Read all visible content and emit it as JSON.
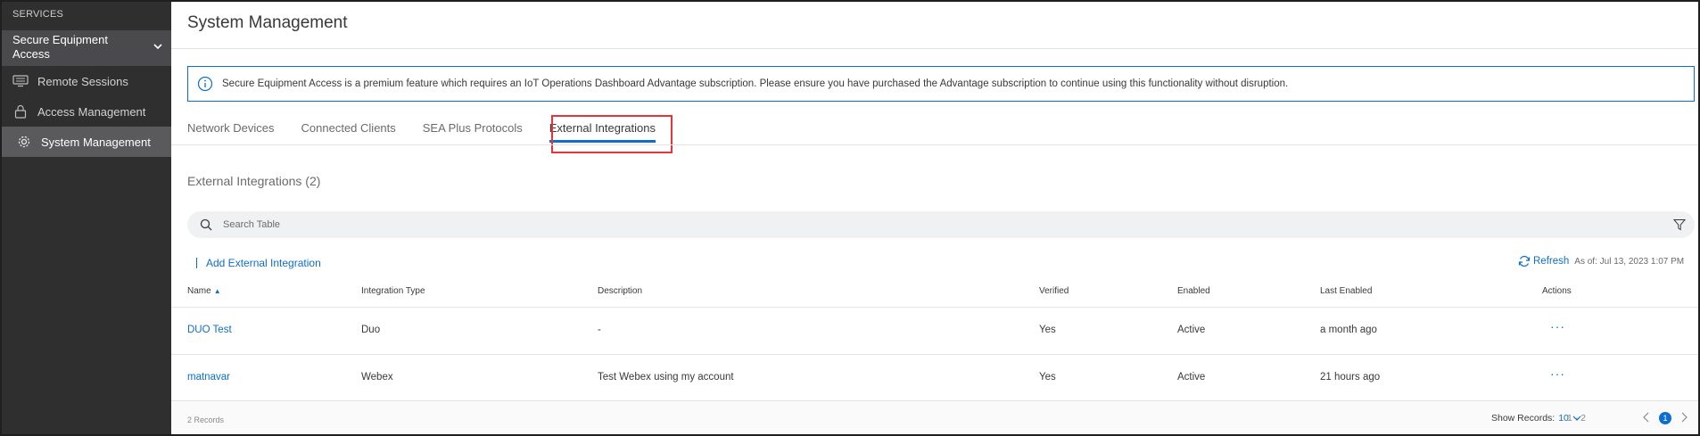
{
  "sidebar": {
    "header": "SERVICES",
    "group_label": "Secure Equipment Access",
    "items": [
      {
        "label": "Remote Sessions",
        "icon": "remote-sessions-icon"
      },
      {
        "label": "Access Management",
        "icon": "lock-icon"
      },
      {
        "label": "System Management",
        "icon": "gear-icon"
      }
    ]
  },
  "page": {
    "title": "System Management",
    "banner": "Secure Equipment Access is a premium feature which requires an IoT Operations Dashboard Advantage subscription. Please ensure you have purchased the Advantage subscription to continue using this functionality without disruption."
  },
  "tabs": [
    {
      "label": "Network Devices"
    },
    {
      "label": "Connected Clients"
    },
    {
      "label": "SEA Plus Protocols"
    },
    {
      "label": "External Integrations"
    }
  ],
  "section": {
    "title": "External Integrations (2)",
    "search_placeholder": "Search Table",
    "add_label": "Add External Integration",
    "refresh_label": "Refresh",
    "as_of": "As of: Jul 13, 2023 1:07 PM"
  },
  "table": {
    "columns": [
      "Name",
      "Integration Type",
      "Description",
      "Verified",
      "Enabled",
      "Last Enabled",
      "Actions"
    ],
    "rows": [
      {
        "name": "DUO Test",
        "type": "Duo",
        "description": "-",
        "verified": "Yes",
        "enabled": "Active",
        "last_enabled": "a month ago",
        "actions": "···"
      },
      {
        "name": "matnavar",
        "type": "Webex",
        "description": "Test Webex using my account",
        "verified": "Yes",
        "enabled": "Active",
        "last_enabled": "21 hours ago",
        "actions": "···"
      }
    ]
  },
  "footer": {
    "records": "2 Records",
    "show_label": "Show Records:",
    "show_value": "10",
    "range": "1 - 2",
    "page": "1"
  },
  "colors": {
    "accent": "#0d6ecc",
    "sidebar_bg": "#2f2f30",
    "highlight": "#e8333a"
  }
}
